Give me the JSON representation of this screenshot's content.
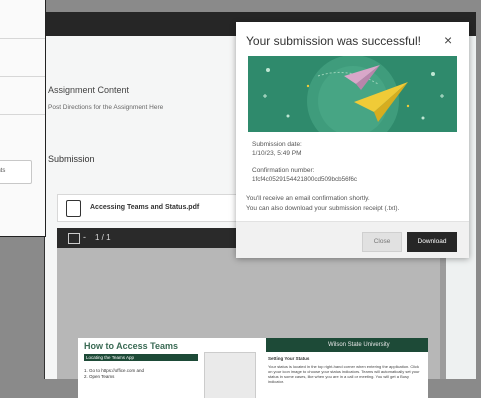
{
  "assignment": {
    "section_title": "Assignment Content",
    "section_subtitle": "Post Directions for the Assignment Here",
    "submission_heading": "Submission",
    "file_name": "Accessing Teams and Status.pdf"
  },
  "viewer": {
    "separator": "-",
    "page_indicator": "1 / 1"
  },
  "document": {
    "title": "How to Access Teams",
    "left_header": "Locating the Teams App",
    "step_1": "1. Go to https://office.com and",
    "step_2": "2. Open Teams",
    "university": "Wilson State University",
    "right_header": "Setting Your Status",
    "right_text": "Your status is located in the top right-hand corner when entering the application. Click on your icon image to choose your status indicators. Teams will automatically set your status in some cases, like when you are in a call or meeting. You will get a Busy indicator."
  },
  "left_window": {
    "button_label": "ints"
  },
  "modal": {
    "title": "Your submission was successful!",
    "submission_date_label": "Submission date:",
    "submission_date": "1/10/23, 5:49 PM",
    "confirmation_label": "Confirmation number:",
    "confirmation_number": "1fcf4c0529154421800cd509bcb56f6c",
    "email_note": "You'll receive an email confirmation shortly.",
    "receipt_note": "You can also download your submission receipt (.txt).",
    "close_button": "Close",
    "download_button": "Download",
    "close_glyph": "×"
  },
  "colors": {
    "banner_green": "#2f8a6c",
    "doc_green": "#1d4a37",
    "dark_bar": "#262626",
    "plane_yellow": "#f0cb37",
    "plane_pink": "#d9a7c9"
  },
  "icons": [
    "close-icon",
    "pdf-file-icon",
    "sidebar-toggle-icon",
    "paper-plane-illustration"
  ]
}
